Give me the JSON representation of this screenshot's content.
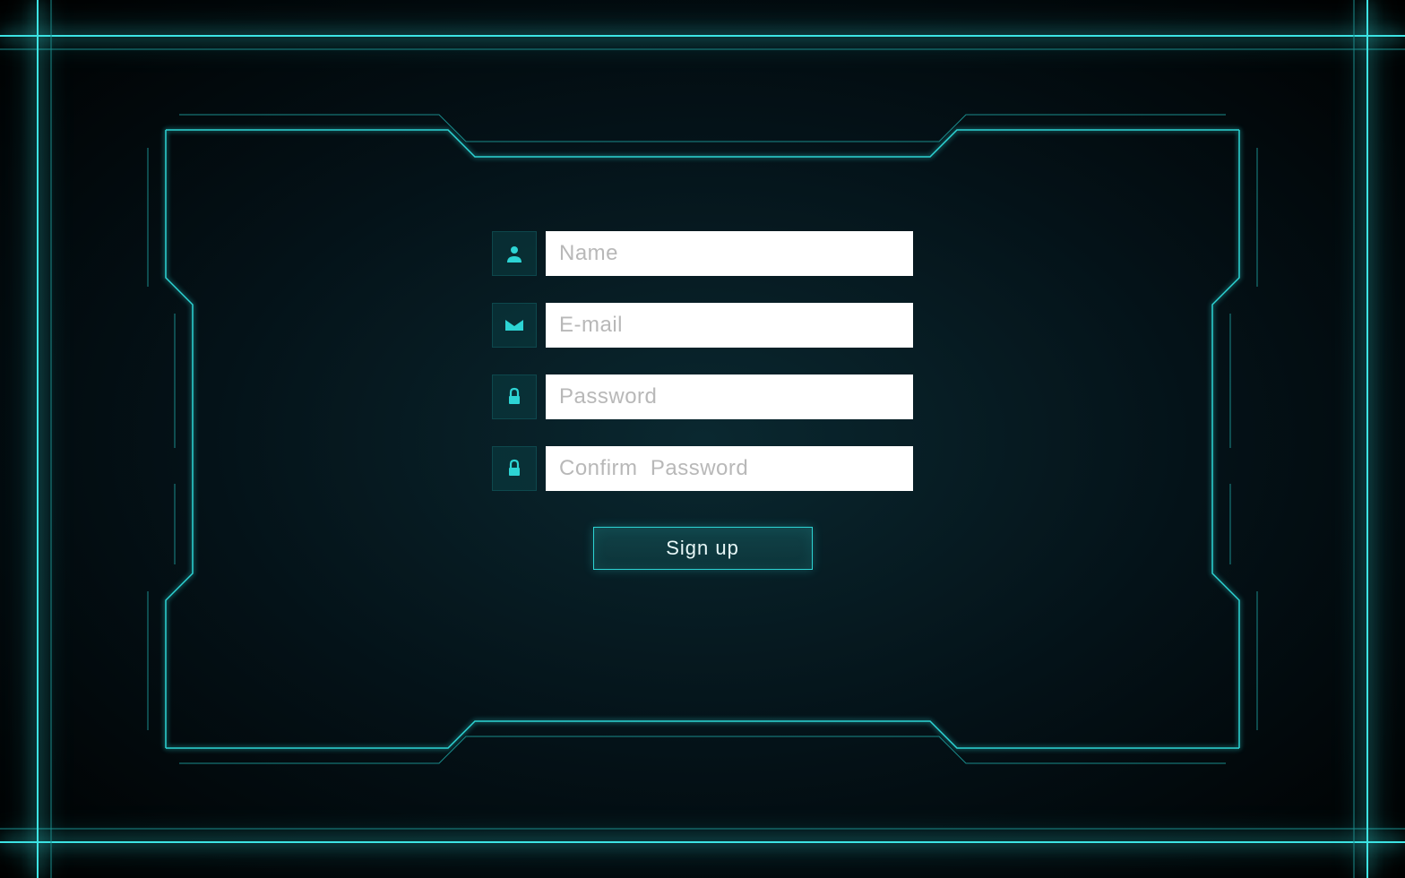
{
  "form": {
    "fields": {
      "name": {
        "placeholder": "Name",
        "value": "",
        "icon": "user-icon"
      },
      "email": {
        "placeholder": "E-mail",
        "value": "",
        "icon": "mail-icon"
      },
      "password": {
        "placeholder": "Password",
        "value": "",
        "icon": "lock-icon"
      },
      "confirm_password": {
        "placeholder": "Confirm  Password",
        "value": "",
        "icon": "lock-icon"
      }
    },
    "submit_label": "Sign  up"
  },
  "colors": {
    "accent": "#2dd4d4",
    "background_dark": "#000000",
    "background_center": "#0a2830",
    "input_bg": "#ffffff",
    "placeholder": "#b8b8b8"
  }
}
